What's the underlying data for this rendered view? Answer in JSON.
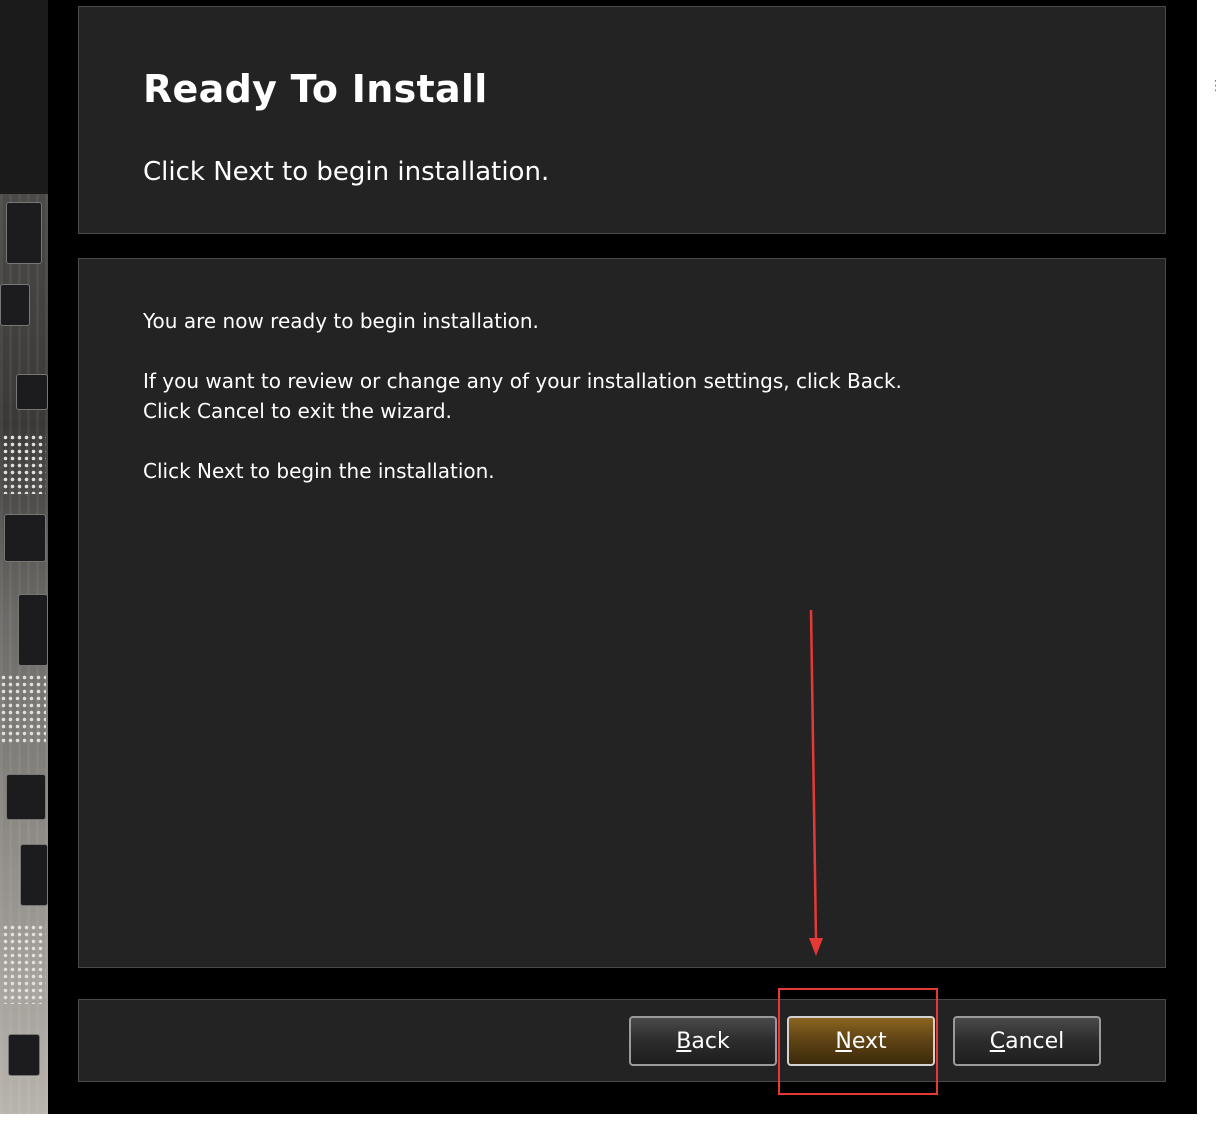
{
  "header": {
    "title": "Ready To Install",
    "subtitle": "Click Next to begin installation."
  },
  "body": {
    "line1": "You are now ready to begin installation.",
    "line2": "If you want to review or change any of your installation settings, click Back.",
    "line3": "Click Cancel to exit the wizard.",
    "line4": "Click Next to begin the installation."
  },
  "footer": {
    "back": {
      "mnemonic": "B",
      "rest": "ack"
    },
    "next": {
      "mnemonic": "N",
      "rest": "ext"
    },
    "cancel": {
      "mnemonic": "C",
      "rest": "ancel"
    }
  },
  "annotation": {
    "color": "#e53935"
  },
  "theme": {
    "accent": "#5e4214",
    "panel": "#232323",
    "text": "#ffffff"
  }
}
